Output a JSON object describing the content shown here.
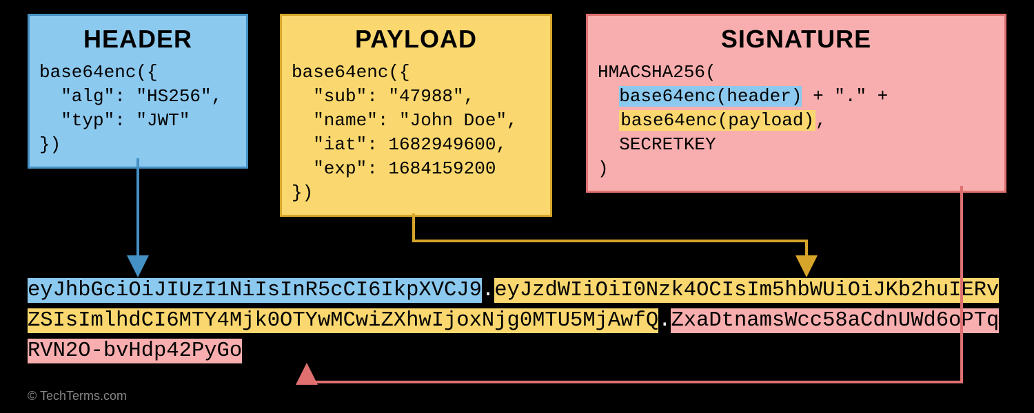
{
  "colors": {
    "blue": "#8CC9EF",
    "yellow": "#FAD86F",
    "pink": "#F8AEAE"
  },
  "header": {
    "title": "HEADER",
    "code": "base64enc({\n  \"alg\": \"HS256\",\n  \"typ\": \"JWT\"\n})"
  },
  "payload": {
    "title": "PAYLOAD",
    "code": "base64enc({\n  \"sub\": \"47988\",\n  \"name\": \"John Doe\",\n  \"iat\": 1682949600,\n  \"exp\": 1684159200\n})"
  },
  "signature": {
    "title": "SIGNATURE",
    "line1a": "HMACSHA256(",
    "line2_hl": "base64enc(header)",
    "line2_tail": " + \".\" +",
    "line3_hl": "base64enc(payload)",
    "line3_tail": ",",
    "line4": "  SECRETKEY",
    "line5": ")"
  },
  "token": {
    "header_part": "eyJhbGciOiJIUzI1NiIsInR5cCI6IkpXVCJ9",
    "payload_part": "eyJzdWIiOiI0Nzk4OCIsIm5hbWUiOiJKb2huIERvZSIsImlhdCI6MTY4Mjk0OTYwMCwiZXhwIjoxNjg0MTU5MjAwfQ",
    "signature_part": "ZxaDtnamsWcc58aCdnUWd6oPTqRVN2O-bvHdp42PyGo"
  },
  "credit": "© TechTerms.com"
}
